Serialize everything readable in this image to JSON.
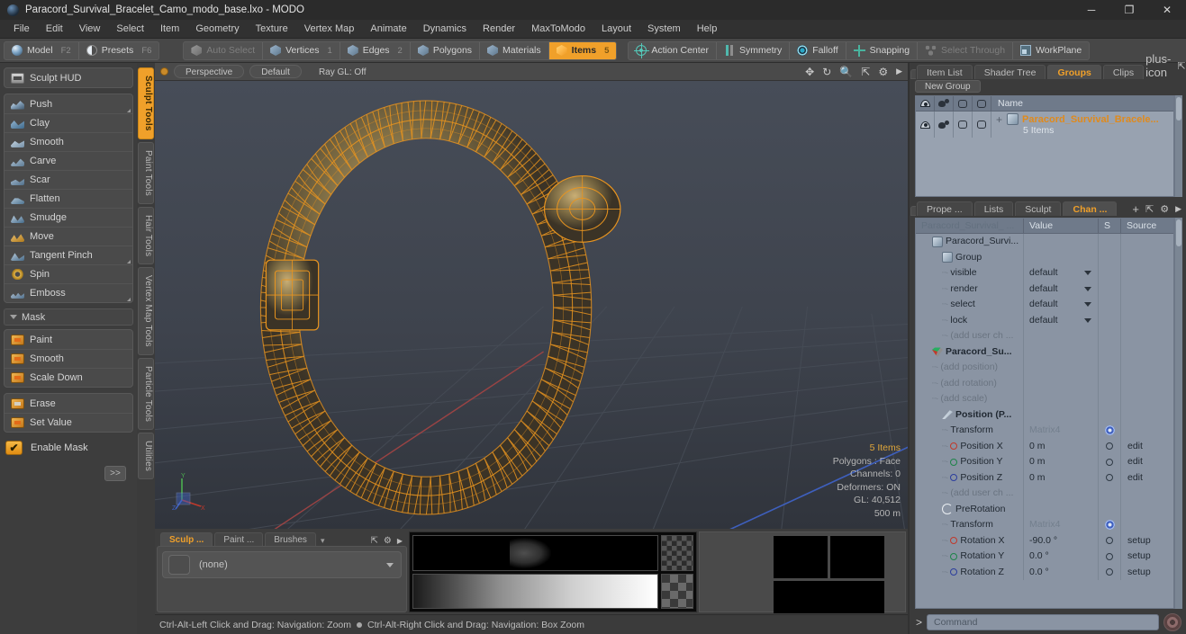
{
  "window": {
    "title": "Paracord_Survival_Bracelet_Camo_modo_base.lxo - MODO",
    "minimize": "─",
    "maximize": "❐",
    "close": "✕"
  },
  "menu": {
    "items": [
      "File",
      "Edit",
      "View",
      "Select",
      "Item",
      "Geometry",
      "Texture",
      "Vertex Map",
      "Animate",
      "Dynamics",
      "Render",
      "MaxToModo",
      "Layout",
      "System",
      "Help"
    ]
  },
  "toolbar": {
    "mode_group": [
      {
        "label": "Model",
        "shortcut": "F2",
        "icon": "sphere-icon",
        "active": false
      },
      {
        "label": "Presets",
        "shortcut": "F6",
        "icon": "half-sphere-icon",
        "active": false
      }
    ],
    "select_group": [
      {
        "label": "Auto Select",
        "num": "",
        "icon": "cube-icon",
        "active": false,
        "dim": true
      },
      {
        "label": "Vertices",
        "num": "1",
        "icon": "cube-icon",
        "active": false,
        "dim": false
      },
      {
        "label": "Edges",
        "num": "2",
        "icon": "cube-icon",
        "active": false,
        "dim": false
      },
      {
        "label": "Polygons",
        "num": "",
        "icon": "cube-icon",
        "active": false,
        "dim": false
      },
      {
        "label": "Materials",
        "num": "",
        "icon": "cube-icon",
        "active": false,
        "dim": false
      },
      {
        "label": "Items",
        "num": "5",
        "icon": "cube-icon",
        "active": true,
        "dim": false
      }
    ],
    "option_group": [
      {
        "label": "Action Center",
        "icon": "action-center-icon",
        "dim": false
      },
      {
        "label": "Symmetry",
        "icon": "symmetry-icon",
        "dim": false
      },
      {
        "label": "Falloff",
        "icon": "falloff-icon",
        "dim": false
      },
      {
        "label": "Snapping",
        "icon": "snapping-icon",
        "dim": false
      },
      {
        "label": "Select Through",
        "icon": "select-through-icon",
        "dim": true
      },
      {
        "label": "WorkPlane",
        "icon": "workplane-icon",
        "dim": false
      }
    ]
  },
  "left_panel": {
    "hud_label": "Sculpt HUD",
    "sculpt_tools": [
      {
        "label": "Push",
        "icon": "push-brush-icon"
      },
      {
        "label": "Clay",
        "icon": "clay-brush-icon"
      },
      {
        "label": "Smooth",
        "icon": "smooth-brush-icon"
      },
      {
        "label": "Carve",
        "icon": "carve-brush-icon"
      },
      {
        "label": "Scar",
        "icon": "scar-brush-icon"
      },
      {
        "label": "Flatten",
        "icon": "flatten-brush-icon"
      },
      {
        "label": "Smudge",
        "icon": "smudge-brush-icon"
      },
      {
        "label": "Move",
        "icon": "move-brush-icon"
      },
      {
        "label": "Tangent Pinch",
        "icon": "tangent-pinch-brush-icon"
      },
      {
        "label": "Spin",
        "icon": "spin-brush-icon"
      },
      {
        "label": "Emboss",
        "icon": "emboss-brush-icon"
      }
    ],
    "mask_header": "Mask",
    "mask_tools": [
      {
        "label": "Paint",
        "icon": "mask-paint-icon"
      },
      {
        "label": "Smooth",
        "icon": "mask-smooth-icon"
      },
      {
        "label": "Scale Down",
        "icon": "mask-scale-down-icon"
      }
    ],
    "mask_tools2": [
      {
        "label": "Erase",
        "icon": "mask-erase-icon"
      },
      {
        "label": "Set Value",
        "icon": "mask-set-value-icon"
      }
    ],
    "enable_mask": "Enable Mask",
    "enable_mask_checked": true,
    "more_label": ">>"
  },
  "vertical_tabs": [
    {
      "label": "Sculpt Tools",
      "active": true
    },
    {
      "label": "Paint Tools",
      "active": false
    },
    {
      "label": "Hair Tools",
      "active": false
    },
    {
      "label": "Vertex Map Tools",
      "active": false
    },
    {
      "label": "Particle Tools",
      "active": false
    },
    {
      "label": "Utilities",
      "active": false
    }
  ],
  "viewport": {
    "view_name": "Perspective",
    "shading": "Default",
    "raygl": "Ray GL: Off",
    "tools": [
      "pan-icon",
      "rotate-icon",
      "zoom-icon",
      "fit-icon",
      "gear-icon",
      "chevron-right-icon"
    ],
    "stats": {
      "items": "5 Items",
      "polygons": "Polygons : Face",
      "channels": "Channels: 0",
      "deformers": "Deformers: ON",
      "gl": "GL: 40,512",
      "scale": "500 m"
    },
    "axis": {
      "x": "X",
      "y": "Y",
      "z": "Z"
    }
  },
  "bottom_dock": {
    "tabs": [
      {
        "label": "Sculp ...",
        "active": true
      },
      {
        "label": "Paint ...",
        "active": false
      },
      {
        "label": "Brushes",
        "active": false
      }
    ],
    "tab_menu_icon": "chevron-down-icon",
    "right_icons": [
      "expand-icon",
      "gear-icon",
      "chevron-right-icon"
    ],
    "preset_value": "(none)"
  },
  "status_bar": {
    "left": "Ctrl-Alt-Left Click and Drag: Navigation: Zoom",
    "right": "Ctrl-Alt-Right Click and Drag: Navigation: Box Zoom"
  },
  "right_panel_top": {
    "tabs": [
      {
        "label": "Item List",
        "active": false
      },
      {
        "label": "Shader Tree",
        "active": false
      },
      {
        "label": "Groups",
        "active": true
      },
      {
        "label": "Clips",
        "active": false
      }
    ],
    "add_icon": "plus-icon",
    "expand_icon": "expand-icon",
    "more_icon": "chevron-right-icon",
    "new_group_button": "New Group",
    "columns": [
      "visible-icon",
      "render-icon",
      "select-icon",
      "lock-icon",
      "Name"
    ],
    "rows": [
      {
        "name": "Paracord_Survival_Bracele...",
        "sub": "5 Items",
        "icon": "group-icon"
      }
    ]
  },
  "right_panel_bottom": {
    "tabs": [
      {
        "label": "Prope ...",
        "active": false
      },
      {
        "label": "Lists",
        "active": false
      },
      {
        "label": "Sculpt",
        "active": false
      },
      {
        "label": "Chan ...",
        "active": true
      }
    ],
    "add_icon": "plus-icon",
    "expand_icon": "expand-icon",
    "gear_icon": "gear-icon",
    "more_icon": "chevron-right-icon",
    "columns": [
      "Paracord_Survival_ ...",
      "Value",
      "S",
      "Source"
    ],
    "rows": [
      {
        "indent": 0,
        "twisty": true,
        "icon": "item-icon",
        "name": "Paracord_Survi...",
        "value": "",
        "s": "",
        "source": "",
        "bold": false
      },
      {
        "indent": 1,
        "twisty": true,
        "icon": "group-icon",
        "name": "Group",
        "value": "",
        "s": "",
        "source": "",
        "bold": false
      },
      {
        "indent": 2,
        "twisty": false,
        "icon": "channel-icon",
        "name": "visible",
        "value": "default",
        "dropdown": true,
        "s": "",
        "source": "",
        "bold": false
      },
      {
        "indent": 2,
        "twisty": false,
        "icon": "channel-icon",
        "name": "render",
        "value": "default",
        "dropdown": true,
        "s": "",
        "source": "",
        "bold": false
      },
      {
        "indent": 2,
        "twisty": false,
        "icon": "channel-icon",
        "name": "select",
        "value": "default",
        "dropdown": true,
        "s": "",
        "source": "",
        "bold": false
      },
      {
        "indent": 2,
        "twisty": false,
        "icon": "channel-icon",
        "name": "lock",
        "value": "default",
        "dropdown": true,
        "s": "",
        "source": "",
        "bold": false
      },
      {
        "indent": 2,
        "twisty": false,
        "icon": "channel-icon",
        "name": "(add user ch ...",
        "value": "",
        "s": "",
        "source": "",
        "dim": true
      },
      {
        "indent": 0,
        "twisty": true,
        "icon": "locator-icon",
        "name": "Paracord_Su...",
        "value": "",
        "s": "",
        "source": "",
        "bold": true
      },
      {
        "indent": 1,
        "twisty": false,
        "icon": "channel-icon",
        "name": "(add position)",
        "value": "",
        "s": "",
        "source": "",
        "dim": true
      },
      {
        "indent": 1,
        "twisty": false,
        "icon": "channel-icon",
        "name": "(add rotation)",
        "value": "",
        "s": "",
        "source": "",
        "dim": true
      },
      {
        "indent": 1,
        "twisty": false,
        "icon": "channel-icon",
        "name": "(add scale)",
        "value": "",
        "s": "",
        "source": "",
        "dim": true
      },
      {
        "indent": 1,
        "twisty": true,
        "icon": "position-icon",
        "name": "Position (P...",
        "value": "",
        "s": "",
        "source": "",
        "bold": true
      },
      {
        "indent": 2,
        "twisty": false,
        "icon": "channel-icon",
        "name": "Transform",
        "value": "Matrix4",
        "valdim": true,
        "s": "gear",
        "source": "",
        "bold": false
      },
      {
        "indent": 2,
        "twisty": false,
        "icon": "ring-red",
        "name": "Position X",
        "value": "0 m",
        "s": "ring",
        "source": "edit",
        "bold": false
      },
      {
        "indent": 2,
        "twisty": false,
        "icon": "ring-green",
        "name": "Position Y",
        "value": "0 m",
        "s": "ring",
        "source": "edit",
        "bold": false
      },
      {
        "indent": 2,
        "twisty": false,
        "icon": "ring-blue",
        "name": "Position Z",
        "value": "0 m",
        "s": "ring",
        "source": "edit",
        "bold": false
      },
      {
        "indent": 2,
        "twisty": false,
        "icon": "channel-icon",
        "name": "(add user ch ...",
        "value": "",
        "s": "",
        "source": "",
        "dim": true
      },
      {
        "indent": 1,
        "twisty": true,
        "icon": "rotation-icon",
        "name": "PreRotation",
        "value": "",
        "s": "",
        "source": "",
        "bold": false
      },
      {
        "indent": 2,
        "twisty": false,
        "icon": "channel-icon",
        "name": "Transform",
        "value": "Matrix4",
        "valdim": true,
        "s": "gear",
        "source": "",
        "bold": false
      },
      {
        "indent": 2,
        "twisty": false,
        "icon": "ring-red",
        "name": "Rotation X",
        "value": "-90.0 °",
        "s": "ring",
        "source": "setup",
        "bold": false
      },
      {
        "indent": 2,
        "twisty": false,
        "icon": "ring-green",
        "name": "Rotation Y",
        "value": "0.0 °",
        "s": "ring",
        "source": "setup",
        "bold": false
      },
      {
        "indent": 2,
        "twisty": false,
        "icon": "ring-blue",
        "name": "Rotation Z",
        "value": "0.0 °",
        "s": "ring",
        "source": "setup",
        "bold": false
      }
    ]
  },
  "command_bar": {
    "prompt": ">",
    "placeholder": "Command",
    "value": "",
    "record_icon": "record-icon"
  },
  "colors": {
    "accent_orange": "#f0a02a",
    "panel_bg": "#3b3b3b",
    "toolbar_bg": "#474747",
    "tree_bg": "#8a94a3",
    "viewport_bg": "#3e434c",
    "wireframe": "#e8941f"
  }
}
